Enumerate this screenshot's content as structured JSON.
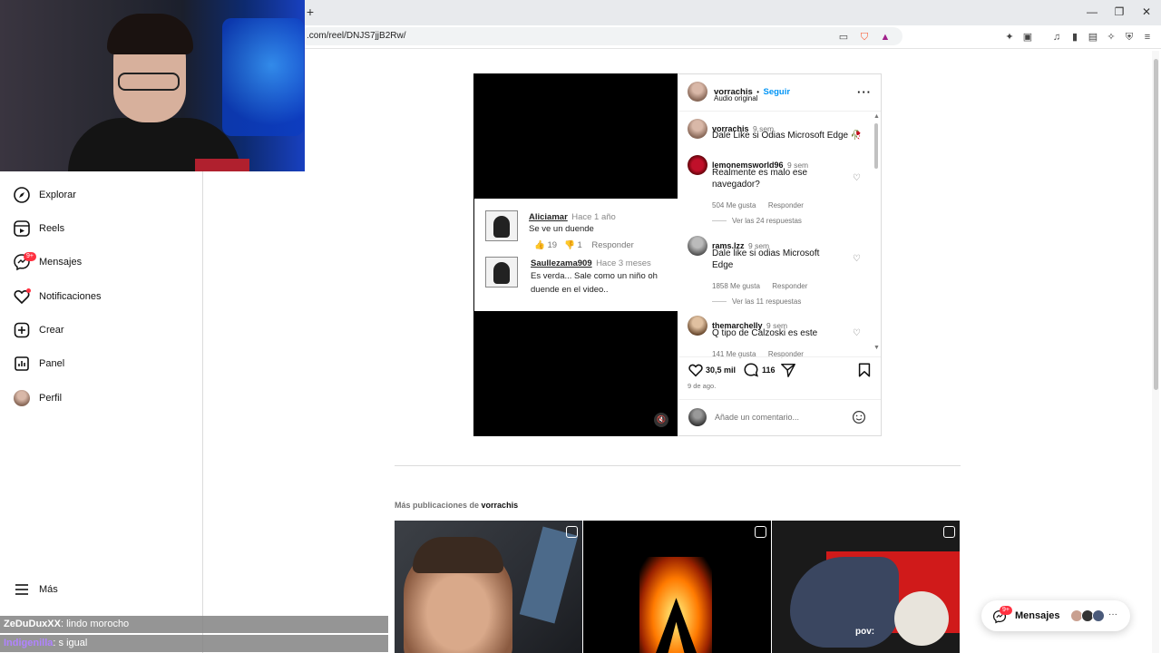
{
  "browser": {
    "url": ".com/reel/DNJS7jjB2Rw/",
    "new_tab": "+",
    "window_controls": [
      "minimize-icon",
      "restore-icon",
      "close-icon"
    ],
    "toolbar_icons": [
      "cast-icon",
      "brave-shield-icon",
      "brave-rewards-icon",
      "extensions-icon",
      "tab-search-icon",
      "music-icon",
      "sidebar-icon",
      "wallet-icon",
      "ai-icon",
      "vpn-icon",
      "menu-icon"
    ]
  },
  "nav": {
    "items": [
      {
        "label": "Explorar",
        "icon": "compass-icon"
      },
      {
        "label": "Reels",
        "icon": "reels-icon"
      },
      {
        "label": "Mensajes",
        "icon": "messenger-icon",
        "badge": "9+"
      },
      {
        "label": "Notificaciones",
        "icon": "heart-icon"
      },
      {
        "label": "Crear",
        "icon": "plus-square-icon"
      },
      {
        "label": "Panel",
        "icon": "dashboard-icon"
      },
      {
        "label": "Perfil",
        "icon": "profile-avatar"
      }
    ],
    "more": "Más"
  },
  "chat": [
    {
      "user": "ZeDuDuxXX",
      "text": ": lindo morocho"
    },
    {
      "user": "Indigenilla",
      "text": ": s igual"
    }
  ],
  "video_overlay": {
    "comment1": {
      "name": "Aliciamar",
      "time": "Hace 1 año",
      "text": "Se ve un duende",
      "likes": "19",
      "dislikes": "1",
      "reply": "Responder"
    },
    "comment2": {
      "name": "Saullezama909",
      "time": "Hace 3 meses",
      "text1": "Es verda... Sale como un niño oh",
      "text2": "duende en el video.."
    }
  },
  "post": {
    "author": "vorrachis",
    "follow": "Seguir",
    "separator": "•",
    "audio": "Audio original",
    "caption": {
      "user": "vorrachis",
      "time": "9 sem",
      "text": "Dale Like si Odias Microsoft Edge 🥀"
    },
    "comments": [
      {
        "user": "lemonemsworld96",
        "time": "9 sem",
        "text": "Realmente es malo ese navegador?",
        "likes": "504 Me gusta",
        "reply": "Responder",
        "replies": "Ver las 24 respuestas"
      },
      {
        "user": "rams.lzz",
        "time": "9 sem",
        "text": "Dale like si odias Microsoft Edge",
        "likes": "1858 Me gusta",
        "reply": "Responder",
        "replies": "Ver las 11 respuestas"
      },
      {
        "user": "themarchelly",
        "time": "9 sem",
        "text": "Q tipo de Calzoski es este",
        "likes": "141 Me gusta",
        "reply": "Responder"
      }
    ],
    "like_count": "30,5 mil",
    "comment_count": "116",
    "date": "9 de ago.",
    "comment_placeholder": "Añade un comentario..."
  },
  "more_posts": {
    "prefix": "Más publicaciones de",
    "author": "vorrachis",
    "thumb3_caption": "pov:"
  },
  "messages_button": {
    "label": "Messages_placeholder",
    "text": "Mensajes",
    "badge": "9+"
  }
}
